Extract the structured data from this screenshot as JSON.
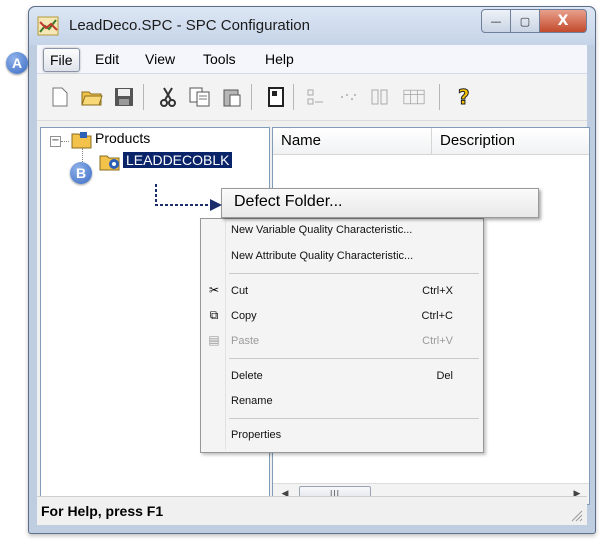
{
  "window": {
    "title": "LeadDeco.SPC - SPC Configuration",
    "buttons": {
      "minimize": "—",
      "maximize": "▢",
      "close": "X"
    }
  },
  "menubar": [
    "File",
    "Edit",
    "View",
    "Tools",
    "Help"
  ],
  "toolbar": {
    "icons": [
      "new-file-icon",
      "open-folder-icon",
      "save-icon",
      "cut-icon",
      "copy-icon",
      "paste-icon",
      "document-icon",
      "grid-icon",
      "dots-icon",
      "columns-icon",
      "details-icon",
      "help-icon"
    ]
  },
  "tree": {
    "root": {
      "label": "Products",
      "expander": "−"
    },
    "child": {
      "label": "LEADDECOBLK"
    }
  },
  "list": {
    "columns": [
      "Name",
      "Description"
    ],
    "scroll_thumb": "III"
  },
  "context_menu": {
    "submenu_item": "Defect Folder...",
    "items": [
      {
        "label": "New Variable Quality Characteristic...",
        "shortcut": ""
      },
      {
        "label": "New Attribute Quality Characteristic...",
        "shortcut": ""
      },
      {
        "label": "Cut",
        "shortcut": "Ctrl+X"
      },
      {
        "label": "Copy",
        "shortcut": "Ctrl+C"
      },
      {
        "label": "Paste",
        "shortcut": "Ctrl+V"
      },
      {
        "label": "Delete",
        "shortcut": "Del"
      },
      {
        "label": "Rename",
        "shortcut": ""
      },
      {
        "label": "Properties",
        "shortcut": ""
      }
    ]
  },
  "statusbar": {
    "text": "For Help, press F1"
  },
  "callouts": {
    "a": "A",
    "b": "B"
  }
}
